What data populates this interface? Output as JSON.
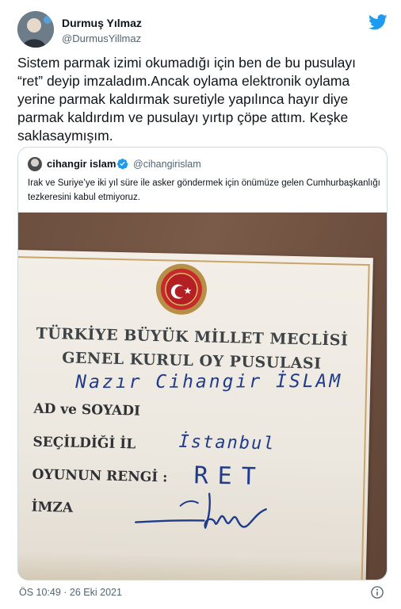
{
  "author": {
    "name": "Durmuş Yılmaz",
    "handle": "@DurmusYillmaz"
  },
  "tweet": {
    "text": "Sistem parmak izimi okumadığı için ben de bu pusulayı “ret” deyip imzaladım.Ancak oylama elektronik oylama yerine parmak kaldırmak suretiyle yapılınca hayır diye parmak kaldırdım ve pusulayı yırtıp çöpe attım. Keşke saklasaymışım.",
    "timestamp": "ÖS 10:49 · 26 Eki 2021"
  },
  "quote": {
    "name": "cihangir islam",
    "handle": "@cihangirislam",
    "text": "Irak ve Suriye’ye iki yıl süre ile asker göndermek için önümüze gelen Cumhurbaşkanlığı tezkeresini kabul etmiyoruz.",
    "verified": true
  },
  "ballot": {
    "title_line1": "TÜRKİYE BÜYÜK MİLLET MECLİSİ",
    "title_line2": "GENEL KURUL OY PUSULASI",
    "handwritten_name": "Nazır Cihangir İSLAM",
    "label_name": "AD ve SOYADI",
    "label_city": "SEÇİLDİĞİ İL",
    "handwritten_city": "İstanbul",
    "label_vote": "OYUNUN RENGİ :",
    "handwritten_vote": "RET",
    "label_signature": "İMZA"
  },
  "icons": {
    "brand": "twitter-bird-icon",
    "verified": "verified-badge-icon",
    "info": "info-icon"
  },
  "colors": {
    "twitter_blue": "#1d9bf0",
    "text_primary": "#0f1419",
    "text_secondary": "#536471",
    "ink_blue": "#1f3b8a"
  }
}
